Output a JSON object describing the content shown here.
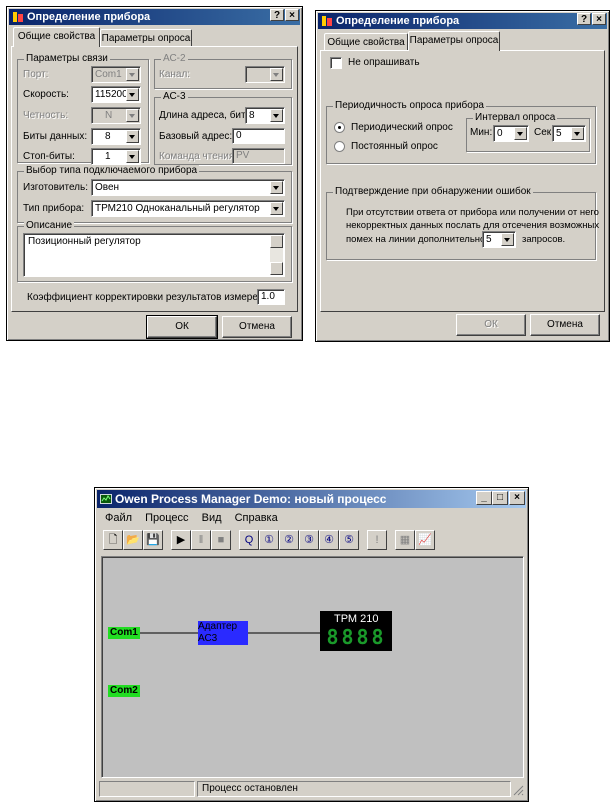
{
  "dialog1": {
    "title": "Определение прибора",
    "tabs": [
      "Общие свойства",
      "Параметры опроса"
    ],
    "link_group": {
      "legend": "Параметры связи",
      "port_label": "Порт:",
      "port_value": "Com1",
      "speed_label": "Скорость:",
      "speed_value": "115200",
      "parity_label": "Четность:",
      "parity_value": "N",
      "databits_label": "Биты данных:",
      "databits_value": "8",
      "stopbits_label": "Стоп-биты:",
      "stopbits_value": "1"
    },
    "ac2_group": {
      "legend": "АС-2",
      "channel_label": "Канал:"
    },
    "ac3_group": {
      "legend": "АС-3",
      "addrlen_label": "Длина адреса, бит:",
      "addrlen_value": "8",
      "baseaddr_label": "Базовый адрес:",
      "baseaddr_value": "0",
      "readcmd_label": "Команда чтения:",
      "readcmd_value": "PV"
    },
    "device_group": {
      "legend": "Выбор типа подключаемого прибора",
      "maker_label": "Изготовитель:",
      "maker_value": "Овен",
      "type_label": "Тип прибора:",
      "type_value": "ТРМ210 Одноканальный регулятор"
    },
    "desc_group": {
      "legend": "Описание",
      "text": "Позиционный регулятор"
    },
    "coef_label": "Коэффициент корректировки результатов измерения:",
    "coef_value": "1.0",
    "ok": "ОК",
    "cancel": "Отмена",
    "help_btn": "?",
    "close_btn": "×"
  },
  "dialog2": {
    "title": "Определение прибора",
    "tabs": [
      "Общие свойства",
      "Параметры опроса"
    ],
    "no_poll_label": "Не опрашивать",
    "period_group": {
      "legend": "Периодичность опроса прибора",
      "periodic_label": "Периодический опрос",
      "constant_label": "Постоянный опрос",
      "interval_group": {
        "legend": "Интервал опроса",
        "min_label": "Мин:",
        "min_value": "0",
        "sec_label": "Сек:",
        "sec_value": "5"
      }
    },
    "confirm_group": {
      "legend": "Подтверждение при обнаружении ошибок",
      "line1": "При отсутствии ответа от прибора или получении от него",
      "line2": "некорректных данных послать для отсечения возможных",
      "line3_prefix": "помех на линии дополнительно",
      "requests_value": "5",
      "line3_suffix": "запросов."
    },
    "ok": "ОК",
    "cancel": "Отмена",
    "help_btn": "?",
    "close_btn": "×"
  },
  "app": {
    "title": "Owen Process Manager Demo: новый процесс",
    "menu": [
      "Файл",
      "Процесс",
      "Вид",
      "Справка"
    ],
    "nodes": {
      "com1": "Com1",
      "com2": "Com2",
      "adapter_line1": "Адаптер",
      "adapter_line2": "АС3",
      "device_label": "ТРМ 210",
      "display_digits": [
        "8",
        "8",
        "8",
        "8"
      ]
    },
    "status": "Процесс остановлен",
    "colors": {
      "com": "#22dd22",
      "adapter": "#2a2aff",
      "device": "#000000",
      "led": "#1a9a2a"
    },
    "minimize_btn": "_",
    "maximize_btn": "□",
    "close_btn": "×"
  }
}
